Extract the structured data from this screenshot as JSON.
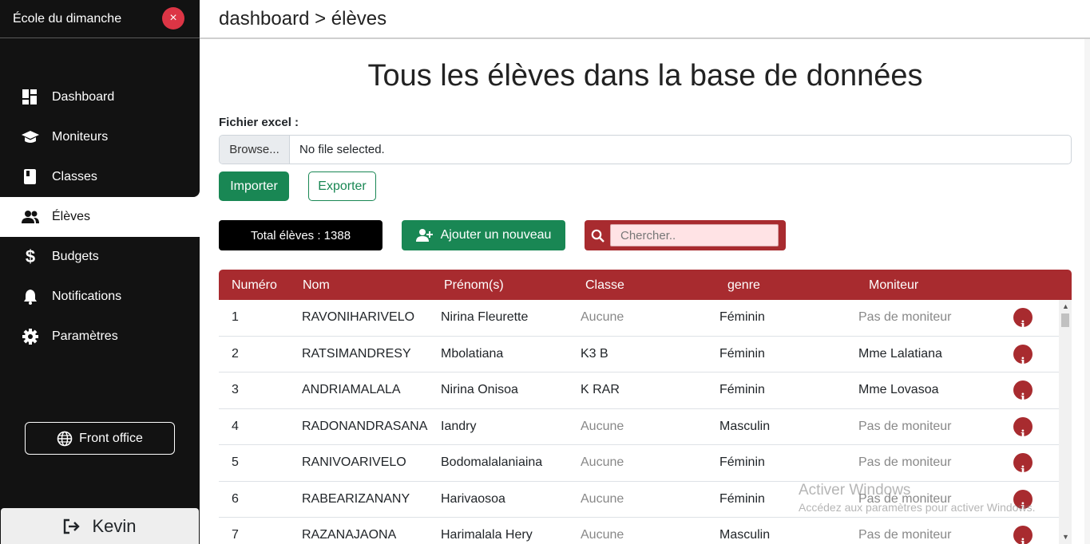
{
  "sidebar": {
    "brand": "École du dimanche",
    "close_symbol": "×",
    "items": [
      {
        "label": "Dashboard",
        "icon": "dashboard-icon"
      },
      {
        "label": "Moniteurs",
        "icon": "graduation-cap-icon"
      },
      {
        "label": "Classes",
        "icon": "book-icon"
      },
      {
        "label": "Élèves",
        "icon": "users-icon",
        "active": true
      },
      {
        "label": "Budgets",
        "icon": "dollar-icon"
      },
      {
        "label": "Notifications",
        "icon": "bell-icon"
      },
      {
        "label": "Paramètres",
        "icon": "gear-icon"
      }
    ],
    "front_office": "Front office",
    "user": "Kevin"
  },
  "breadcrumb": "dashboard > élèves",
  "page_title": "Tous les élèves dans la base de données",
  "file": {
    "label": "Fichier excel :",
    "browse": "Browse...",
    "status": "No file selected."
  },
  "actions": {
    "import": "Importer",
    "export": "Exporter",
    "total": "Total élèves : 1388",
    "add": "Ajouter un nouveau",
    "search_placeholder": "Chercher.."
  },
  "table": {
    "headers": [
      "Numéro",
      "Nom",
      "Prénom(s)",
      "Classe",
      "genre",
      "Moniteur"
    ],
    "rows": [
      {
        "num": "1",
        "nom": "RAVONIHARIVELO",
        "prenom": "Nirina Fleurette",
        "classe": "Aucune",
        "genre": "Féminin",
        "moniteur": "Pas de moniteur"
      },
      {
        "num": "2",
        "nom": "RATSIMANDRESY",
        "prenom": "Mbolatiana",
        "classe": "K3 B",
        "genre": "Féminin",
        "moniteur": "Mme Lalatiana"
      },
      {
        "num": "3",
        "nom": "ANDRIAMALALA",
        "prenom": "Nirina Onisoa",
        "classe": "K RAR",
        "genre": "Féminin",
        "moniteur": "Mme Lovasoa"
      },
      {
        "num": "4",
        "nom": "RADONANDRASANA",
        "prenom": "Iandry",
        "classe": "Aucune",
        "genre": "Masculin",
        "moniteur": "Pas de moniteur"
      },
      {
        "num": "5",
        "nom": "RANIVOARIVELO",
        "prenom": "Bodomalalaniaina",
        "classe": "Aucune",
        "genre": "Féminin",
        "moniteur": "Pas de moniteur"
      },
      {
        "num": "6",
        "nom": "RABEARIZANANY",
        "prenom": "Harivaosoa",
        "classe": "Aucune",
        "genre": "Féminin",
        "moniteur": "Pas de moniteur"
      },
      {
        "num": "7",
        "nom": "RAZANAJAONA",
        "prenom": "Harimalala Hery",
        "classe": "Aucune",
        "genre": "Masculin",
        "moniteur": "Pas de moniteur"
      }
    ]
  },
  "watermark": {
    "line1": "Activer Windows",
    "line2": "Accédez aux paramètres pour activer Windows."
  },
  "colors": {
    "sidebar": "#121212",
    "accent_red": "#a82b2f",
    "success": "#198754",
    "close": "#dc3545"
  }
}
